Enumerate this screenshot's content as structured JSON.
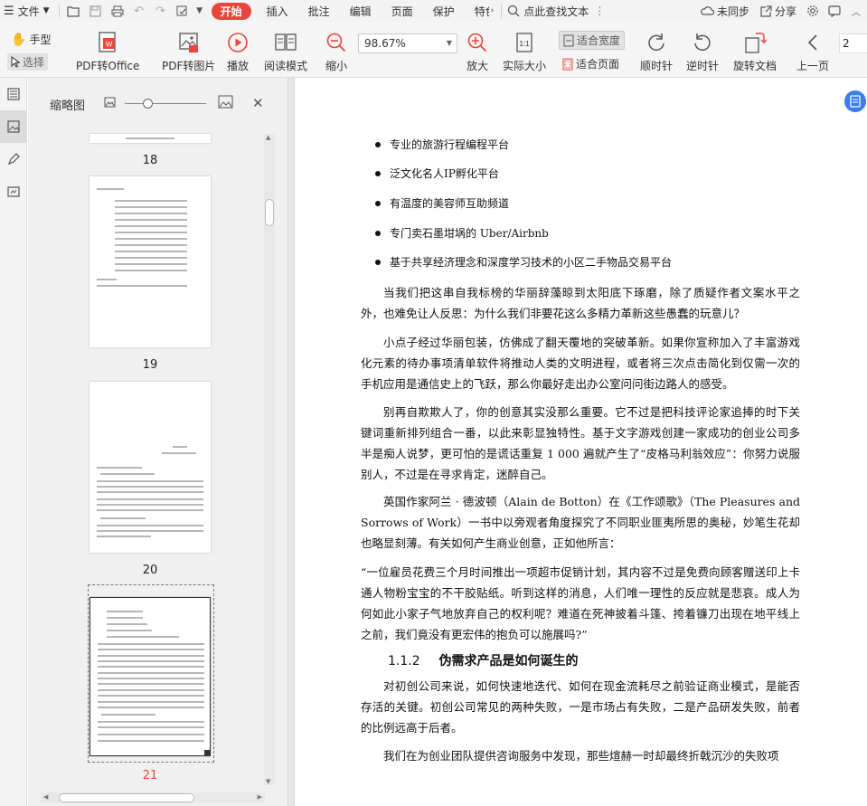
{
  "menubar": {
    "file_label": "文件",
    "tabs": [
      "开始",
      "插入",
      "批注",
      "编辑",
      "页面",
      "保护",
      "特色"
    ],
    "active_tab": "开始",
    "search_label": "点此查找文本",
    "sync_label": "未同步",
    "share_label": "分享"
  },
  "toolbar": {
    "hand_label": "手型",
    "select_label": "选择",
    "pdf_to_office": "PDF转Office",
    "pdf_to_image": "PDF转图片",
    "play": "播放",
    "read_mode": "阅读模式",
    "zoom_out": "缩小",
    "zoom_value": "98.67%",
    "zoom_in": "放大",
    "actual_size": "实际大小",
    "fit_width": "适合宽度",
    "fit_page": "适合页面",
    "rotate_cw": "顺时针",
    "rotate_ccw": "逆时针",
    "rotate_doc": "旋转文档",
    "prev_page": "上一页",
    "page_input": "2"
  },
  "thumbnails": {
    "title": "缩略图",
    "pages": [
      "18",
      "19",
      "20",
      "21"
    ],
    "current_page": "21"
  },
  "document": {
    "bullets": [
      "专业的旅游行程编程平台",
      "泛文化名人IP孵化平台",
      "有温度的美容师互助频道",
      "专门卖石墨坩埚的 Uber/Airbnb",
      "基于共享经济理念和深度学习技术的小区二手物品交易平台"
    ],
    "paragraphs": [
      "当我们把这串自我标榜的华丽辞藻晾到太阳底下琢磨，除了质疑作者文案水平之外，也难免让人反思：为什么我们非要花这么多精力革新这些愚蠢的玩意儿？",
      "小点子经过华丽包装，仿佛成了翻天覆地的突破革新。如果你宣称加入了丰富游戏化元素的待办事项清单软件将推动人类的文明进程，或者将三次点击简化到仅需一次的手机应用是通信史上的飞跃，那么你最好走出办公室问问街边路人的感受。",
      "别再自欺欺人了，你的创意其实没那么重要。它不过是把科技评论家追捧的时下关键词重新排列组合一番，以此来彰显独特性。基于文字游戏创建一家成功的创业公司多半是痴人说梦，更可怕的是谎话重复 1 000 遍就产生了“皮格马利翁效应”：你努力说服别人，不过是在寻求肯定，迷醉自己。",
      "英国作家阿兰 · 德波顿（Alain de Botton）在《工作颂歌》（The Pleasures and Sorrows of Work）一书中以旁观者角度探究了不同职业匪夷所思的奥秘，妙笔生花却也略显刻薄。有关如何产生商业创意，正如他所言："
    ],
    "quote": "“一位雇员花费三个月时间推出一项超市促销计划，其内容不过是免费向顾客赠送印上卡通人物粉宝宝的不干胶贴纸。听到这样的消息，人们唯一理性的反应就是悲哀。成人为何如此小家子气地放弃自己的权利呢？难道在死神披着斗篷、挎着镰刀出现在地平线上之前，我们竟没有更宏伟的抱负可以施展吗?”",
    "section_number": "1.1.2",
    "section_title": "伪需求产品是如何诞生的",
    "after_paragraphs": [
      "对初创公司来说，如何快速地迭代、如何在现金流耗尽之前验证商业模式，是能否存活的关键。初创公司常见的两种失败，一是市场占有失败，二是产品研发失败，前者的比例远高于后者。",
      "我们在为创业团队提供咨询服务中发现，那些煊赫一时却最终折戟沉沙的失败项"
    ]
  },
  "colors": {
    "accent": "#e8453c",
    "float_button": "#3b7cf0"
  }
}
